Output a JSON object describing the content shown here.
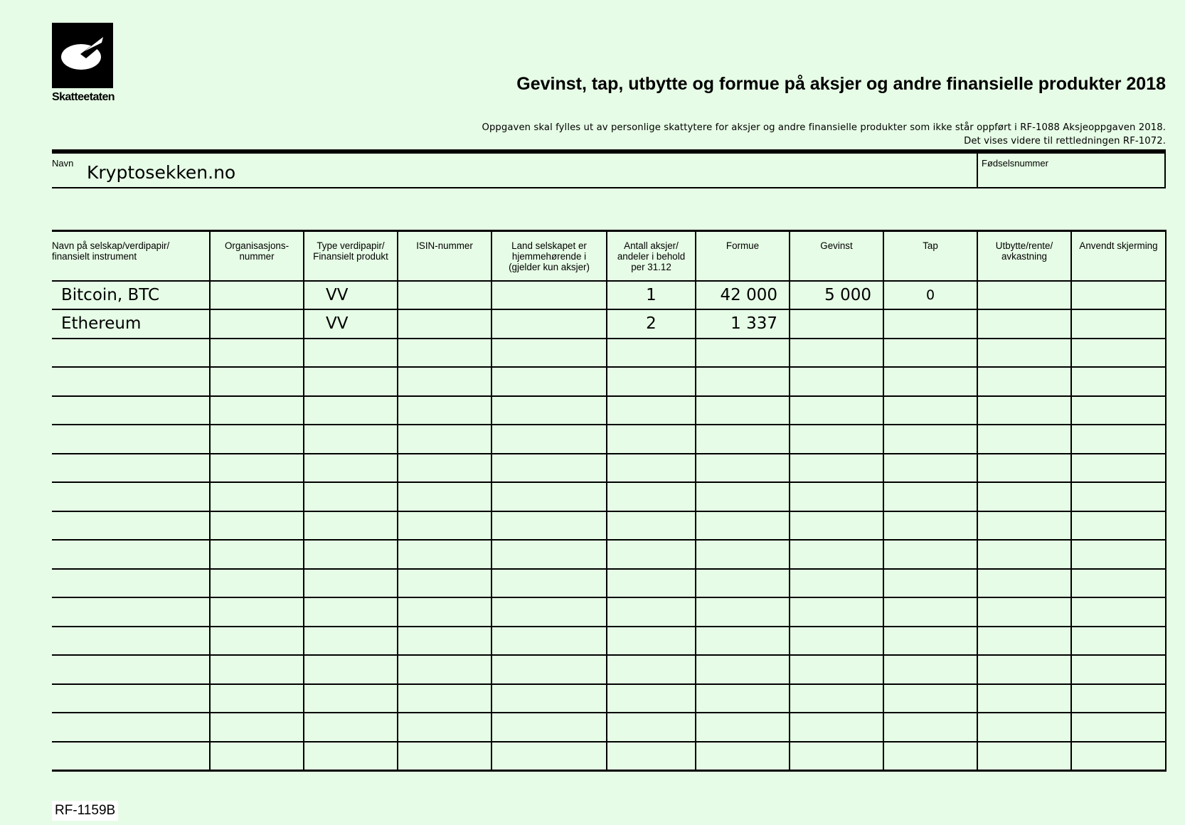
{
  "logo": {
    "text": "Skatteetaten"
  },
  "title": "Gevinst, tap, utbytte og formue på aksjer og andre finansielle produkter 2018",
  "subtitle": [
    "Oppgaven skal fylles ut av personlige skattytere for aksjer og andre finansielle produkter som ikke står oppført i RF-1088 Aksjeoppgaven 2018.",
    "Det vises videre til rettledningen RF-1072."
  ],
  "identity": {
    "name_label": "Navn",
    "name_value": "Kryptosekken.no",
    "fnr_label": "Fødselsnummer",
    "fnr_value": ""
  },
  "table": {
    "headers": [
      "Navn på selskap/verdipapir/\nfinansielt instrument",
      "Organisasjons-\nnummer",
      "Type verdipapir/\nFinansielt produkt",
      "ISIN-nummer",
      "Land selskapet er\nhjemmehørende i\n(gjelder kun aksjer)",
      "Antall aksjer/\nandeler i behold\nper 31.12",
      "Formue",
      "Gevinst",
      "Tap",
      "Utbytte/rente/\navkastning",
      "Anvendt skjerming"
    ],
    "rows": [
      [
        "Bitcoin, BTC",
        "",
        "VV",
        "",
        "",
        "1",
        "42 000",
        "5 000",
        "0",
        "",
        ""
      ],
      [
        "Ethereum",
        "",
        "VV",
        "",
        "",
        "2",
        "1 337",
        "",
        "",
        "",
        ""
      ],
      [
        "",
        "",
        "",
        "",
        "",
        "",
        "",
        "",
        "",
        "",
        ""
      ],
      [
        "",
        "",
        "",
        "",
        "",
        "",
        "",
        "",
        "",
        "",
        ""
      ],
      [
        "",
        "",
        "",
        "",
        "",
        "",
        "",
        "",
        "",
        "",
        ""
      ],
      [
        "",
        "",
        "",
        "",
        "",
        "",
        "",
        "",
        "",
        "",
        ""
      ],
      [
        "",
        "",
        "",
        "",
        "",
        "",
        "",
        "",
        "",
        "",
        ""
      ],
      [
        "",
        "",
        "",
        "",
        "",
        "",
        "",
        "",
        "",
        "",
        ""
      ],
      [
        "",
        "",
        "",
        "",
        "",
        "",
        "",
        "",
        "",
        "",
        ""
      ],
      [
        "",
        "",
        "",
        "",
        "",
        "",
        "",
        "",
        "",
        "",
        ""
      ],
      [
        "",
        "",
        "",
        "",
        "",
        "",
        "",
        "",
        "",
        "",
        ""
      ],
      [
        "",
        "",
        "",
        "",
        "",
        "",
        "",
        "",
        "",
        "",
        ""
      ],
      [
        "",
        "",
        "",
        "",
        "",
        "",
        "",
        "",
        "",
        "",
        ""
      ],
      [
        "",
        "",
        "",
        "",
        "",
        "",
        "",
        "",
        "",
        "",
        ""
      ],
      [
        "",
        "",
        "",
        "",
        "",
        "",
        "",
        "",
        "",
        "",
        ""
      ],
      [
        "",
        "",
        "",
        "",
        "",
        "",
        "",
        "",
        "",
        "",
        ""
      ],
      [
        "",
        "",
        "",
        "",
        "",
        "",
        "",
        "",
        "",
        "",
        ""
      ]
    ]
  },
  "form_code": "RF-1159B",
  "colors": {
    "background": "#e6fce6",
    "ink": "#000000"
  }
}
